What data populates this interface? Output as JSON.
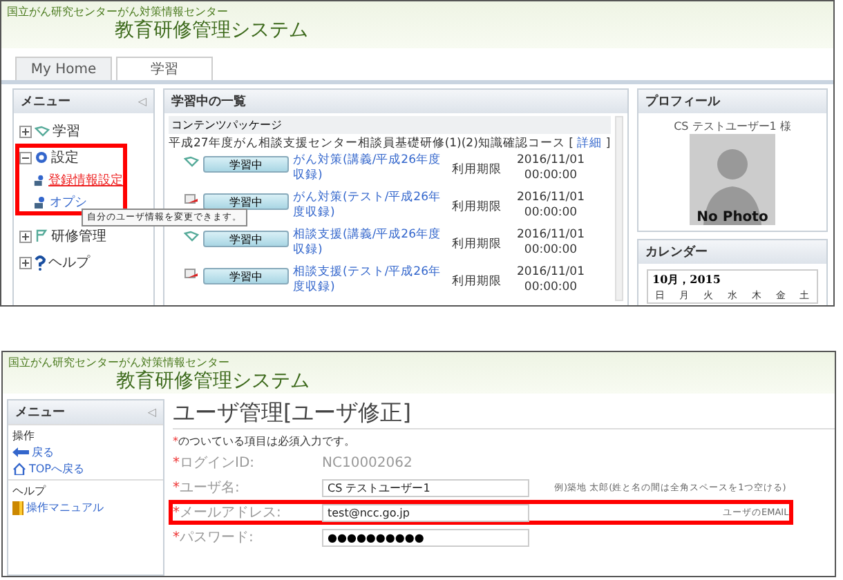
{
  "top_screen": {
    "header": {
      "organization": "国立がん研究センターがん対策情報センター",
      "system": "教育研修管理システム"
    },
    "tabs": [
      {
        "label": "My Home",
        "selected": false
      },
      {
        "label": "学習",
        "selected": true
      }
    ],
    "menu": {
      "title": "メニュー",
      "collapse": "◁",
      "items": [
        {
          "label": "学習",
          "expanded": false,
          "highlighted": false
        },
        {
          "label": "設定",
          "expanded": true,
          "highlighted": true,
          "children": [
            {
              "label": "登録情報設定",
              "selected": true
            },
            {
              "label": "オプシ",
              "selected": false
            }
          ]
        },
        {
          "label": "研修管理",
          "expanded": false,
          "highlighted": false
        },
        {
          "label": "ヘルプ",
          "expanded": false,
          "highlighted": false
        }
      ],
      "tooltip": "自分のユーザ情報を変更できます。"
    },
    "learning_list": {
      "title": "学習中の一覧",
      "package": "コンテンツパッケージ",
      "course": "平成27年度がん相談支援センター相談員基礎研修(1)(2)知識確認コース",
      "detail_open": "[",
      "detail_link": "詳細",
      "detail_close": "]",
      "rows": [
        {
          "kind": "lecture",
          "status": "学習中",
          "title": "がん対策(講義/平成26年度収録)",
          "limit_label": "利用期限",
          "date": "2016/11/01",
          "time": "00:00:00"
        },
        {
          "kind": "test",
          "status": "学習中",
          "title": "がん対策(テスト/平成26年度収録)",
          "limit_label": "利用期限",
          "date": "2016/11/01",
          "time": "00:00:00"
        },
        {
          "kind": "lecture",
          "status": "学習中",
          "title": "相談支援(講義/平成26年度収録)",
          "limit_label": "利用期限",
          "date": "2016/11/01",
          "time": "00:00:00"
        },
        {
          "kind": "test",
          "status": "学習中",
          "title": "相談支援(テスト/平成26年度収録)",
          "limit_label": "利用期限",
          "date": "2016/11/01",
          "time": "00:00:00"
        }
      ]
    },
    "profile": {
      "title": "プロフィール",
      "user": "CS テストユーザー1 様",
      "photo_caption": "No Photo"
    },
    "calendar": {
      "title": "カレンダー",
      "month": "10月，2015",
      "weekdays": [
        "日",
        "月",
        "火",
        "水",
        "木",
        "金",
        "土"
      ]
    }
  },
  "bottom_screen": {
    "header": {
      "organization": "国立がん研究センターがん対策情報センター",
      "system": "教育研修管理システム"
    },
    "menu": {
      "title": "メニュー",
      "collapse": "◁",
      "sections": [
        {
          "heading": "操作",
          "links": [
            {
              "label": "戻る"
            },
            {
              "label": "TOPへ戻る"
            }
          ]
        },
        {
          "heading": "ヘルプ",
          "links": [
            {
              "label": "操作マニュアル"
            }
          ]
        }
      ]
    },
    "form": {
      "title": "ユーザ管理[ユーザ修正]",
      "note_mark": "*",
      "note": "のついている項目は必須入力です。",
      "fields": [
        {
          "kind": "static",
          "mark": "*",
          "label": "ログインID:",
          "value": "NC10002062",
          "highlighted": false
        },
        {
          "kind": "text",
          "mark": "*",
          "label": "ユーザ名:",
          "value": "CS テストユーザー1",
          "hint": "例)築地 太郎(姓と名の間は全角スペースを1つ空ける)",
          "highlighted": false
        },
        {
          "kind": "text",
          "mark": "*",
          "label": "メールアドレス:",
          "value": "test@ncc.go.jp",
          "hint": "ユーザのEMAIL",
          "highlighted": true
        },
        {
          "kind": "password",
          "mark": "*",
          "label": "パスワード:",
          "value": "●●●●●●●●●●",
          "highlighted": false
        }
      ]
    }
  }
}
